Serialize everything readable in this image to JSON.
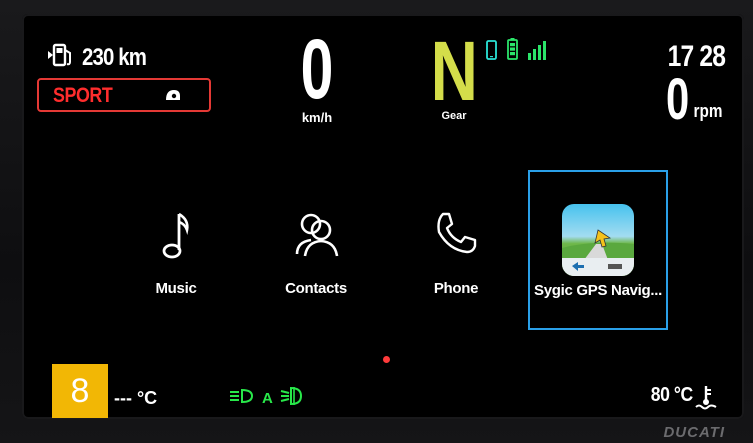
{
  "status_bar": {
    "fuel_range": "230 km",
    "riding_mode": "SPORT",
    "speed": "0",
    "speed_unit": "km/h",
    "gear": "N",
    "gear_label": "Gear",
    "time": "17 28",
    "rpm": "0",
    "rpm_unit": "rpm",
    "gear_color": "#d4dd4a",
    "mode_color": "#ff2d2d"
  },
  "apps": [
    {
      "label": "Music",
      "icon": "music-note-icon"
    },
    {
      "label": "Contacts",
      "icon": "contacts-icon"
    },
    {
      "label": "Phone",
      "icon": "phone-icon"
    },
    {
      "label": "Sygic GPS Navig...",
      "icon": "sygic-navigation-icon",
      "selected": true
    }
  ],
  "bottom_bar": {
    "badge": "8",
    "ambient_temp": "--- °C",
    "lights_label": "A",
    "engine_temp": "80 °C"
  },
  "brand": "DUCATI",
  "colors": {
    "selection": "#2aa0e8",
    "lights": "#28e84a",
    "badge": "#f2b705"
  }
}
